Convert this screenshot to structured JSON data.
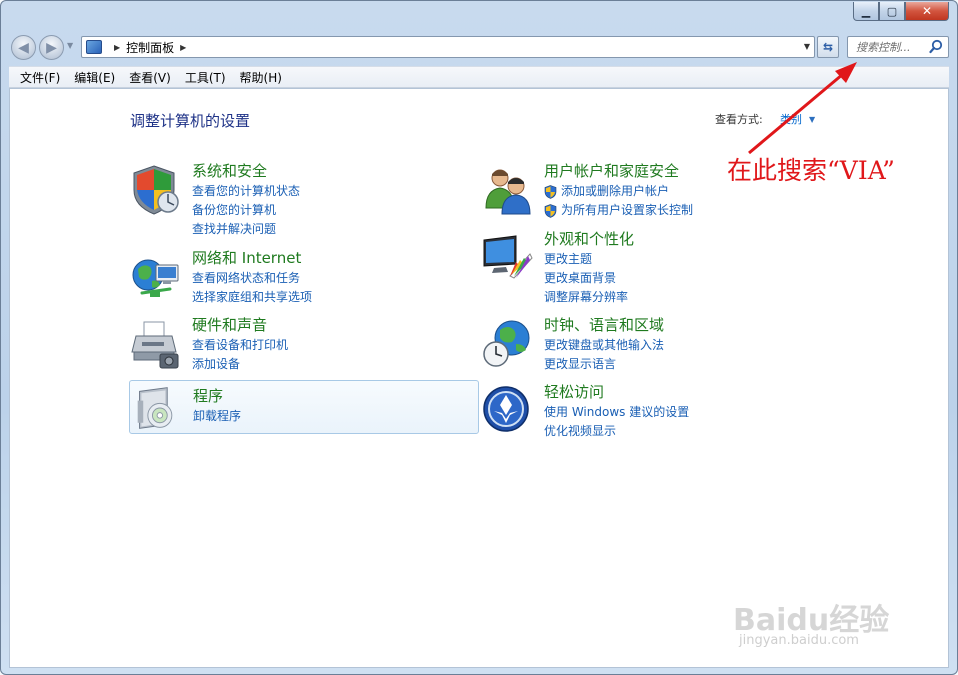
{
  "window": {
    "minimize": "▁",
    "maximize": "▢",
    "close": "✕"
  },
  "nav": {
    "breadcrumb": "控制面板",
    "search_placeholder": "搜索控制..."
  },
  "menu": [
    "文件(F)",
    "编辑(E)",
    "查看(V)",
    "工具(T)",
    "帮助(H)"
  ],
  "main": {
    "title": "调整计算机的设置",
    "view_by_label": "查看方式:",
    "view_by_value": "类别"
  },
  "categories": [
    {
      "title": "系统和安全",
      "icon": "shield-icon",
      "links": [
        "查看您的计算机状态",
        "备份您的计算机",
        "查找并解决问题"
      ]
    },
    {
      "title": "网络和 Internet",
      "icon": "network-globe-icon",
      "links": [
        "查看网络状态和任务",
        "选择家庭组和共享选项"
      ]
    },
    {
      "title": "硬件和声音",
      "icon": "printer-icon",
      "links": [
        "查看设备和打印机",
        "添加设备"
      ]
    },
    {
      "title": "程序",
      "icon": "programs-disc-icon",
      "links": [
        "卸载程序"
      ]
    },
    {
      "title": "用户帐户和家庭安全",
      "icon": "users-icon",
      "links": [
        "添加或删除用户帐户",
        "为所有用户设置家长控制"
      ]
    },
    {
      "title": "外观和个性化",
      "icon": "monitor-palette-icon",
      "links": [
        "更改主题",
        "更改桌面背景",
        "调整屏幕分辨率"
      ]
    },
    {
      "title": "时钟、语言和区域",
      "icon": "clock-globe-icon",
      "links": [
        "更改键盘或其他输入法",
        "更改显示语言"
      ]
    },
    {
      "title": "轻松访问",
      "icon": "ease-of-access-icon",
      "links": [
        "使用 Windows 建议的设置",
        "优化视频显示"
      ]
    }
  ],
  "annotation": "在此搜索“VIA”",
  "watermark": {
    "brand": "Baidu经验",
    "url": "jingyan.baidu.com"
  },
  "colors": {
    "title_green": "#1f7a1f",
    "link_blue": "#1a5fb4",
    "annotation_red": "#e0171a"
  }
}
